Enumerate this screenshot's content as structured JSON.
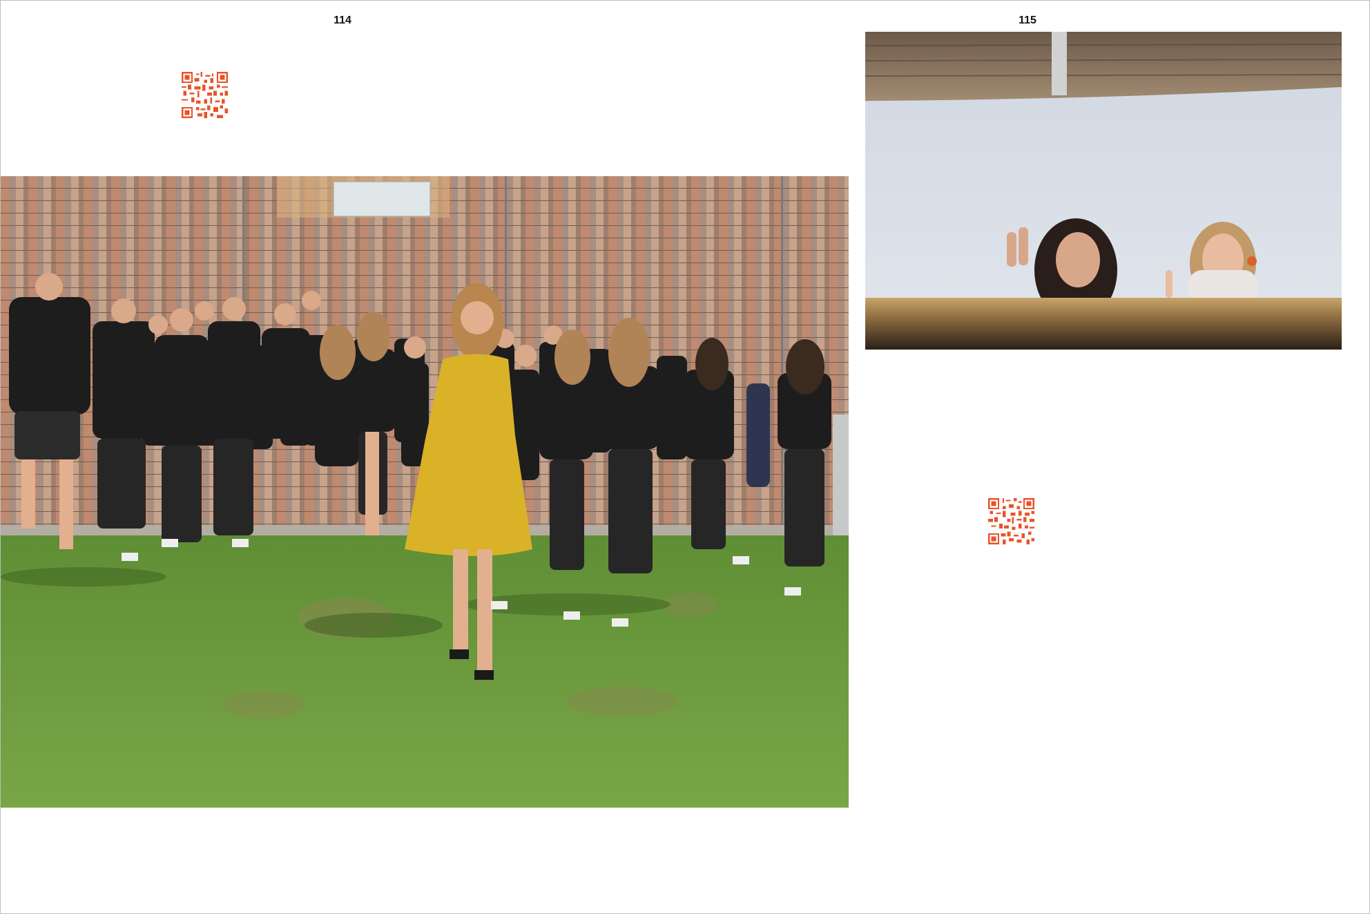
{
  "pages": {
    "left": {
      "number": "114"
    },
    "right": {
      "number": "115"
    }
  },
  "colors": {
    "qr_accent": "#e8542a",
    "dress_yellow": "#d9b227",
    "grass": "#6f9a3a",
    "wall": "#b48a6e"
  },
  "images": {
    "left_photo": {
      "icon": "group-photo"
    },
    "right_photo": {
      "icon": "portrait-photo"
    }
  },
  "qr_codes": [
    {
      "icon": "qr-code-icon"
    },
    {
      "icon": "qr-code-icon"
    }
  ]
}
